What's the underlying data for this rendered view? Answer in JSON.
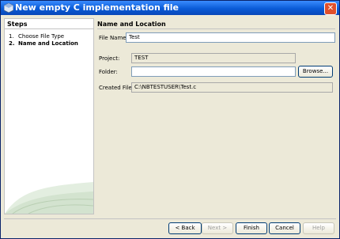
{
  "window": {
    "title": "New empty C implementation file"
  },
  "steps": {
    "title": "Steps",
    "items": [
      {
        "num": "1.",
        "label": "Choose File Type"
      },
      {
        "num": "2.",
        "label": "Name and Location"
      }
    ]
  },
  "main": {
    "title": "Name and Location",
    "file_name_label": "File Name:",
    "file_name_value": "Test",
    "project_label": "Project:",
    "project_value": "TEST",
    "folder_label": "Folder:",
    "folder_value": "",
    "browse_label": "Browse...",
    "created_file_label": "Created File:",
    "created_file_value": "C:\\NBTESTUSER\\Test.c"
  },
  "buttons": {
    "back": "< Back",
    "next": "Next >",
    "finish": "Finish",
    "cancel": "Cancel",
    "help": "Help"
  }
}
